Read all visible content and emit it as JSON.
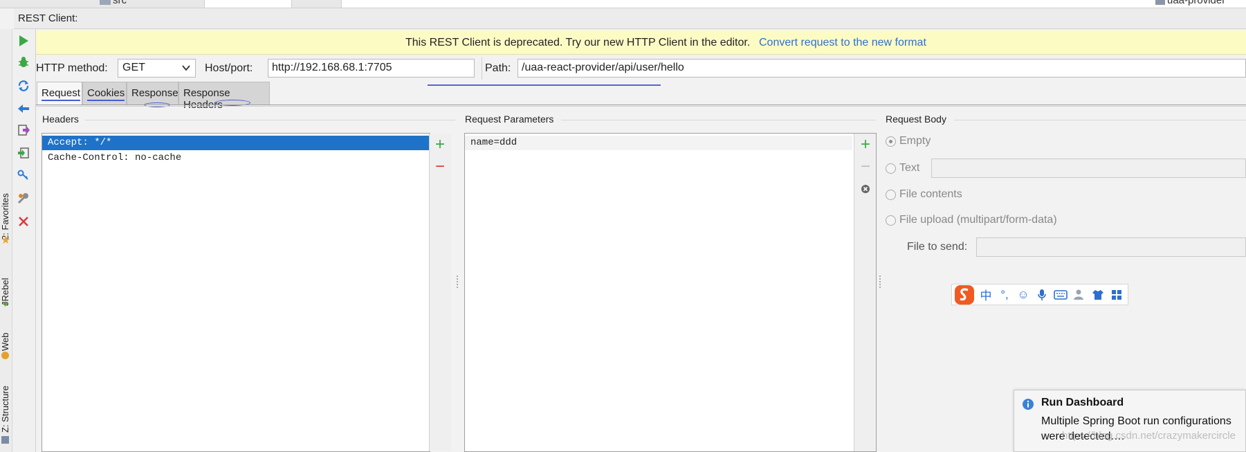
{
  "top": {
    "left_item": "src",
    "right_item": "uaa-provider"
  },
  "window": {
    "title": "REST Client:"
  },
  "banner": {
    "message": "This REST Client is deprecated. Try our new HTTP Client in the editor.",
    "link": "Convert request to the new format"
  },
  "request": {
    "method_label": "HTTP method:",
    "method_value": "GET",
    "host_label": "Host/port:",
    "host_value": "http://192.168.68.1:7705",
    "path_label": "Path:",
    "path_value": "/uaa-react-provider/api/user/hello"
  },
  "tabs": [
    "Request",
    "Cookies",
    "Response",
    "Response Headers"
  ],
  "headers": {
    "title": "Headers",
    "rows": [
      "Accept: */*",
      "Cache-Control: no-cache"
    ]
  },
  "params": {
    "title": "Request Parameters",
    "rows": [
      "name=ddd"
    ]
  },
  "body": {
    "title": "Request Body",
    "options": [
      "Empty",
      "Text",
      "File contents",
      "File upload (multipart/form-data)"
    ],
    "selected": "Empty",
    "file_label": "File to send:"
  },
  "side_panels": [
    "2: Favorites",
    "JRebel",
    "Web",
    "Z: Structure"
  ],
  "ime": {
    "chars": [
      "中",
      "°,"
    ]
  },
  "notification": {
    "title": "Run Dashboard",
    "message": "Multiple Spring Boot run configurations were detected.…"
  },
  "watermark": "https://blog.csdn.net/crazymakercircle",
  "colors": {
    "banner_bg": "#fdfbc4",
    "link": "#2f6fd1",
    "selection": "#1e73c8",
    "add": "#3aa845",
    "remove": "#d93a3a"
  },
  "icons": [
    "run-icon",
    "bug-icon",
    "sync-icon",
    "back-icon",
    "export-icon",
    "import-icon",
    "key-icon",
    "wrench-icon",
    "close-icon",
    "add-icon",
    "remove-icon",
    "info-icon",
    "sogou-icon"
  ]
}
